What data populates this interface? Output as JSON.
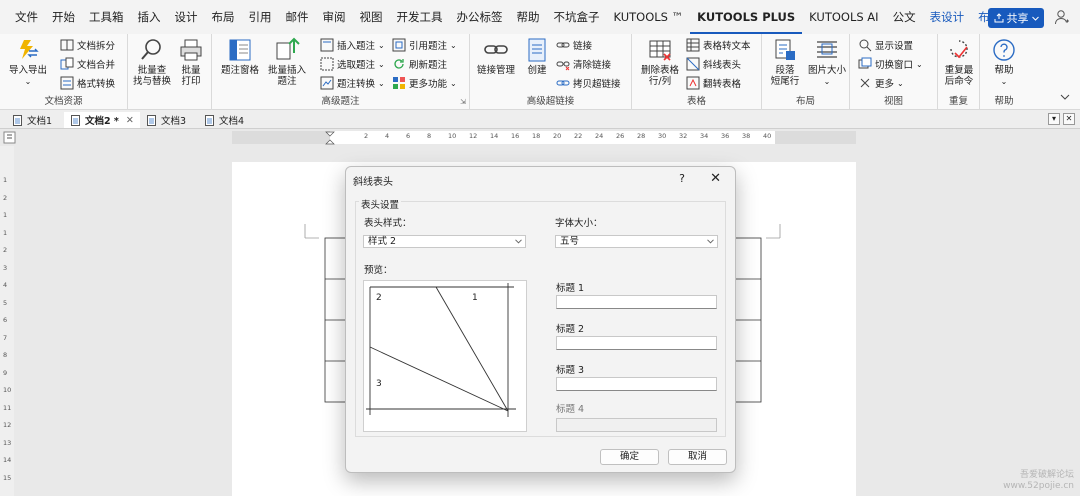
{
  "menu": {
    "items": [
      "文件",
      "开始",
      "工具箱",
      "插入",
      "设计",
      "布局",
      "引用",
      "邮件",
      "审阅",
      "视图",
      "开发工具",
      "办公标签",
      "帮助",
      "不坑盒子",
      "KUTOOLS ™",
      "KUTOOLS PLUS",
      "KUTOOLS AI",
      "公文",
      "表设计",
      "布局"
    ],
    "share_label": "共享"
  },
  "ribbon": {
    "g1": {
      "label": "文档资源",
      "big": "导入导出",
      "small": [
        "文档拆分",
        "文档合并",
        "格式转换"
      ]
    },
    "g2": {
      "big1": "批量查\n找与替换",
      "big2": "批量\n打印"
    },
    "g3": {
      "label": "高级题注",
      "big1": "题注窗格",
      "big2": "批量插入\n题注",
      "small": [
        "插入题注",
        "选取题注",
        "题注转换",
        "引用题注",
        "刷新题注",
        "更多功能"
      ]
    },
    "g4": {
      "label": "高级超链接",
      "big1": "链接管理",
      "big2": "创建",
      "small": [
        "链接",
        "清除链接",
        "拷贝超链接"
      ]
    },
    "g5": {
      "label": "表格",
      "big": "删除表格\n行/列",
      "small": [
        "表格转文本",
        "斜线表头",
        "翻转表格"
      ]
    },
    "g6": {
      "label": "布局",
      "big1": "段落\n短尾行",
      "big2": "图片大小"
    },
    "g7": {
      "label": "视图",
      "small": [
        "显示设置",
        "切换窗口",
        "更多"
      ]
    },
    "g8": {
      "label": "重复",
      "big": "重复最\n后命令"
    },
    "g9": {
      "label": "帮助",
      "big": "帮助"
    }
  },
  "tabs": [
    {
      "label": "文档1"
    },
    {
      "label": "文档2 *"
    },
    {
      "label": "文档3"
    },
    {
      "label": "文档4"
    }
  ],
  "ruler": {
    "h": [
      "2",
      "4",
      "6",
      "8",
      "10",
      "12",
      "14",
      "16",
      "18",
      "20",
      "22",
      "24",
      "26",
      "28",
      "30",
      "32",
      "34",
      "36",
      "38",
      "40"
    ],
    "v": [
      "1",
      "2",
      "1",
      "1",
      "2",
      "3",
      "4",
      "5",
      "6",
      "7",
      "8",
      "9",
      "10",
      "11",
      "12",
      "13",
      "14",
      "15"
    ]
  },
  "dialog": {
    "title": "斜线表头",
    "help": "?",
    "close": "✕",
    "group_label": "表头设置",
    "style_label": "表头样式：",
    "style_value": "样式 2",
    "font_label": "字体大小：",
    "font_value": "五号",
    "preview_label": "预览：",
    "preview_nums": [
      "2",
      "1",
      "3"
    ],
    "title1": "标题 1",
    "title2": "标题 2",
    "title3": "标题 3",
    "title4": "标题 4",
    "ok": "确定",
    "cancel": "取消"
  },
  "watermark": {
    "line1": "吾爱破解论坛",
    "line2": "www.52pojie.cn"
  },
  "colors": {
    "accent": "#185abd",
    "ribbon_bg": "#f9f9f9",
    "dialog_bg": "#f3f3f3"
  }
}
